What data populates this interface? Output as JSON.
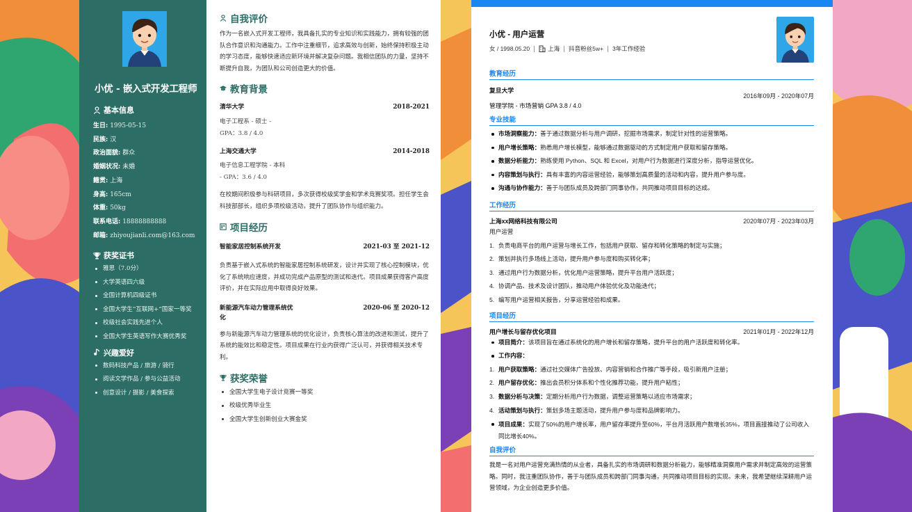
{
  "colors": {
    "sidebar": "#2c6e66",
    "accent_green": "#2c6e66",
    "accent_blue": "#1a86f2",
    "background": "#f5c55a"
  },
  "resume1": {
    "name_title": "小优 - 嵌入式开发工程师",
    "basic_info": {
      "heading": "基本信息",
      "rows": [
        {
          "label": "生日:",
          "value": "1995-05-15"
        },
        {
          "label": "民族:",
          "value": "汉"
        },
        {
          "label": "政治面貌:",
          "value": "群众"
        },
        {
          "label": "婚姻状况:",
          "value": "未婚"
        },
        {
          "label": "籍贯:",
          "value": "上海"
        },
        {
          "label": "身高:",
          "value": "165cm"
        },
        {
          "label": "体重:",
          "value": "50kg"
        },
        {
          "label": "联系电话:",
          "value": "18888888888"
        },
        {
          "label": "邮箱:",
          "value": "zhiyoujianli.com@163.com"
        }
      ]
    },
    "certificates": {
      "heading": "获奖证书",
      "items": [
        "雅思（7.0分）",
        "大学英语四六级",
        "全国计算机四级证书",
        "全国大学生“互联网+”国家一等奖",
        "校级社会实践先进个人",
        "全国大学生英语写作大赛优秀奖"
      ]
    },
    "hobbies": {
      "heading": "兴趣爱好",
      "items": [
        "数码科技产品 / 旅游 / 骑行",
        "阅读文学作品 / 参与公益活动",
        "创意设计 / 摄影 / 美食探索"
      ]
    },
    "self_eval": {
      "heading": "自我评价",
      "text": "作为一名嵌入式开发工程师，我具备扎实的专业知识和实践能力，拥有较强的团队合作意识和沟通能力。工作中注重细节，追求高效与创新，始终保持积极主动的学习态度，能够快速适应新环境并解决复杂问题。我相信团队的力量，坚持不断提升自我，为团队和公司创造更大的价值。"
    },
    "education": {
      "heading": "教育背景",
      "entries": [
        {
          "school": "清华大学",
          "date": "2018-2021",
          "line1": "电子工程系 - 硕士 -",
          "line2": "GPA：3.8 / 4.0"
        },
        {
          "school": "上海交通大学",
          "date": "2014-2018",
          "line1": "电子信息工程学院 - 本科",
          "line2": "- GPA：3.6 / 4.0"
        }
      ],
      "note": "在校期间积极参与科研项目，多次获得校级奖学金和学术竞赛奖项。担任学生会科技部部长，组织多项校级活动，提升了团队协作与组织能力。"
    },
    "projects": {
      "heading": "项目经历",
      "entries": [
        {
          "name": "智能家居控制系统开发",
          "date": "2021-03 至 2021-12",
          "desc": "负责基于嵌入式系统的智能家居控制系统研发，设计并实现了核心控制模块，优化了系统响应速度，并成功完成产品原型的测试和迭代。项目成果获得客户高度评价，并在实际应用中取得良好效果。"
        },
        {
          "name": "新能源汽车动力管理系统优化",
          "date": "2020-06 至 2020-12",
          "desc": "参与新能源汽车动力管理系统的优化设计，负责核心算法的改进和测试，提升了系统的能效比和稳定性。项目成果在行业内获得广泛认可，并获得相关技术专利。"
        }
      ]
    },
    "honors": {
      "heading": "获奖荣誉",
      "items": [
        "全国大学生电子设计竞赛一等奖",
        "校级优秀毕业生",
        "全国大学生创新创业大赛金奖"
      ]
    }
  },
  "resume2": {
    "name_title": "小优 - 用户运营",
    "meta": {
      "gender_birth": "女 / 1998.05.20",
      "city": "上海",
      "followers": "抖音粉丝5w+",
      "experience": "3年工作经验"
    },
    "education": {
      "heading": "教育经历",
      "school": "复旦大学",
      "date": "2016年09月 - 2020年07月",
      "detail": "管理学院 - 市场营销 GPA 3.8 / 4.0"
    },
    "skills": {
      "heading": "专业技能",
      "items": [
        {
          "title": "市场洞察能力：",
          "text": "善于通过数据分析与用户调研，挖掘市场需求，制定针对性的运营策略。"
        },
        {
          "title": "用户增长策略：",
          "text": "熟悉用户增长模型，能够通过数据驱动的方式制定用户获取和留存策略。"
        },
        {
          "title": "数据分析能力：",
          "text": "熟练使用 Python、SQL 和 Excel，对用户行为数据进行深度分析，指导运营优化。"
        },
        {
          "title": "内容策划与执行：",
          "text": "具有丰富的内容运营经验，能够策划高质量的活动和内容，提升用户参与度。"
        },
        {
          "title": "沟通与协作能力：",
          "text": "善于与团队成员及跨部门同事协作，共同推动项目目标的达成。"
        }
      ]
    },
    "work": {
      "heading": "工作经历",
      "company": "上海xx网络科技有限公司",
      "date": "2020年07月 - 2023年03月",
      "role": "用户运营",
      "items": [
        "负责电商平台的用户运营与增长工作，包括用户获取、留存和转化策略的制定与实施；",
        "策划并执行多场线上活动，提升用户参与度和购买转化率；",
        "通过用户行为数据分析，优化用户运营策略，提升平台用户活跃度；",
        "协调产品、技术及设计团队，推动用户体验优化及功能迭代；",
        "编写用户运营相关报告，分享运营经验和成果。"
      ]
    },
    "project": {
      "heading": "项目经历",
      "name": "用户增长与留存优化项目",
      "date": "2021年01月 - 2022年12月",
      "intro_title": "项目简介：",
      "intro": "该项目旨在通过系统化的用户增长和留存策略，提升平台的用户活跃度和转化率。",
      "content_title": "工作内容：",
      "steps": [
        {
          "title": "用户获取策略：",
          "text": "通过社交媒体广告投放、内容营销和合作推广等手段，吸引新用户注册；"
        },
        {
          "title": "用户留存优化：",
          "text": "推出会员积分体系和个性化推荐功能，提升用户粘性；"
        },
        {
          "title": "数据分析与决策：",
          "text": "定期分析用户行为数据，调整运营策略以适应市场需求；"
        },
        {
          "title": "活动策划与执行：",
          "text": "策划多场主题活动，提升用户参与度和品牌影响力。"
        }
      ],
      "result_title": "项目成果：",
      "result": "实现了50%的用户增长率，用户留存率提升至60%，平台月活跃用户数增长35%，项目直接推动了公司收入同比增长40%。"
    },
    "self_eval": {
      "heading": "自我评价",
      "text": "我是一名对用户运营充满热情的从业者，具备扎实的市场调研和数据分析能力，能够精准洞察用户需求并制定高效的运营策略。同时，我注重团队协作，善于与团队成员和跨部门同事沟通，共同推动项目目标的实现。未来，我希望继续深耕用户运营领域，为企业创造更多价值。"
    }
  }
}
